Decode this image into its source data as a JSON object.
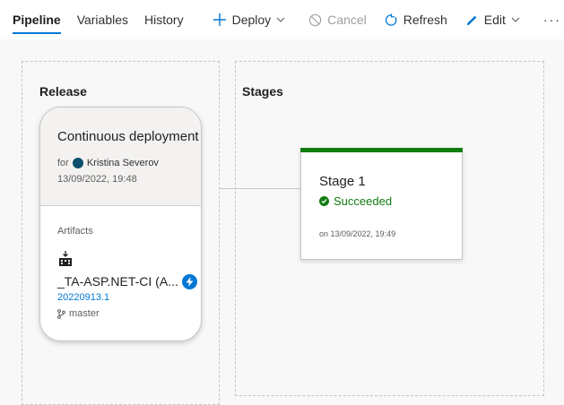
{
  "toolbar": {
    "tabs": [
      {
        "label": "Pipeline",
        "active": true
      },
      {
        "label": "Variables",
        "active": false
      },
      {
        "label": "History",
        "active": false
      }
    ],
    "deploy_label": "Deploy",
    "cancel_label": "Cancel",
    "refresh_label": "Refresh",
    "edit_label": "Edit",
    "more_label": "···"
  },
  "release": {
    "section_title": "Release",
    "trigger_title": "Continuous deployment",
    "for_label": "for",
    "avatar_initials": "KS",
    "user_name": "Kristina Severov",
    "date": "13/09/2022, 19:48",
    "artifacts_label": "Artifacts",
    "artifact_name": "_TA-ASP.NET-CI (A...",
    "build_number": "20220913.1",
    "branch": "master"
  },
  "stages": {
    "section_title": "Stages",
    "items": [
      {
        "name": "Stage 1",
        "status": "Succeeded",
        "timestamp": "on 13/09/2022, 19:49"
      }
    ]
  },
  "colors": {
    "accent": "#0078d4",
    "success": "#107c10",
    "canvas_bg": "#f8f8f8"
  },
  "icons": {
    "deploy": "plus-icon",
    "cancel": "cancel-icon",
    "refresh": "refresh-icon",
    "edit": "pencil-icon",
    "artifact": "build-artifact-icon",
    "trigger": "lightning-icon",
    "branch": "branch-icon",
    "status": "check-circle-icon"
  }
}
